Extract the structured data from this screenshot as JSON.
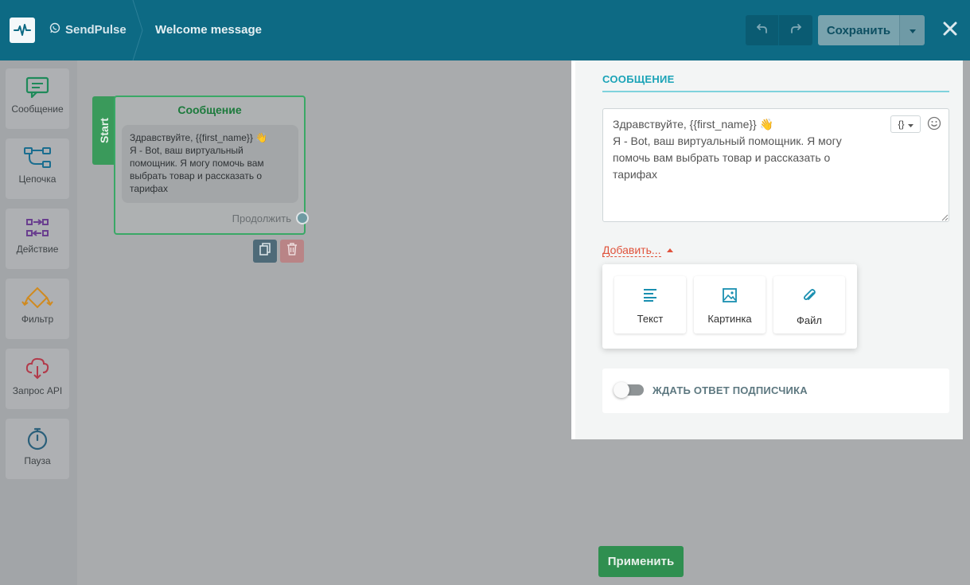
{
  "header": {
    "brand": "SendPulse",
    "flow_title": "Welcome message",
    "save_label": "Сохранить",
    "icons": {
      "logo": "pulse-logo-icon",
      "messenger": "whatsapp-icon",
      "undo": "undo-icon",
      "redo": "redo-icon",
      "save_menu": "caret-down-icon",
      "close": "close-icon"
    }
  },
  "sidebar": {
    "items": [
      {
        "label": "Сообщение",
        "icon": "message-icon",
        "color": "#1f8a5a"
      },
      {
        "label": "Цепочка",
        "icon": "chain-icon",
        "color": "#1a6d8f"
      },
      {
        "label": "Действие",
        "icon": "action-icon",
        "color": "#6a3f8f"
      },
      {
        "label": "Фильтр",
        "icon": "filter-icon",
        "color": "#d08a1f"
      },
      {
        "label": "Запрос API",
        "icon": "api-icon",
        "color": "#b23a4a"
      },
      {
        "label": "Пауза",
        "icon": "timer-icon",
        "color": "#2a5f7a"
      }
    ]
  },
  "canvas": {
    "start_label": "Start",
    "node": {
      "title": "Сообщение",
      "message": "Здравствуйте,  {{first_name}} 👋\nЯ - Bot, ваш виртуальный помощник. Я могу помочь вам выбрать товар и рассказать о тарифах",
      "continue_label": "Продолжить"
    }
  },
  "panel": {
    "section_title": "СООБЩЕНИЕ",
    "message_text": "Здравствуйте,  {{first_name}} 👋\nЯ - Bot, ваш виртуальный помощник. Я могу\nпомочь вам выбрать товар и рассказать о\nтарифах",
    "variable_button": "{}",
    "add_label": "Добавить...",
    "add_options": [
      {
        "label": "Текст",
        "icon": "text-icon"
      },
      {
        "label": "Картинка",
        "icon": "image-icon"
      },
      {
        "label": "Файл",
        "icon": "paperclip-icon"
      }
    ],
    "wait_reply_label": "ЖДАТЬ ОТВЕТ ПОДПИСЧИКА",
    "wait_reply_enabled": false
  },
  "footer": {
    "apply_label": "Применить"
  },
  "colors": {
    "header_bg": "#0d6a84",
    "accent_teal": "#1aa3b7",
    "start_green": "#3a9a5b",
    "apply_green": "#2f8f50",
    "add_link_red": "#e0533c"
  }
}
